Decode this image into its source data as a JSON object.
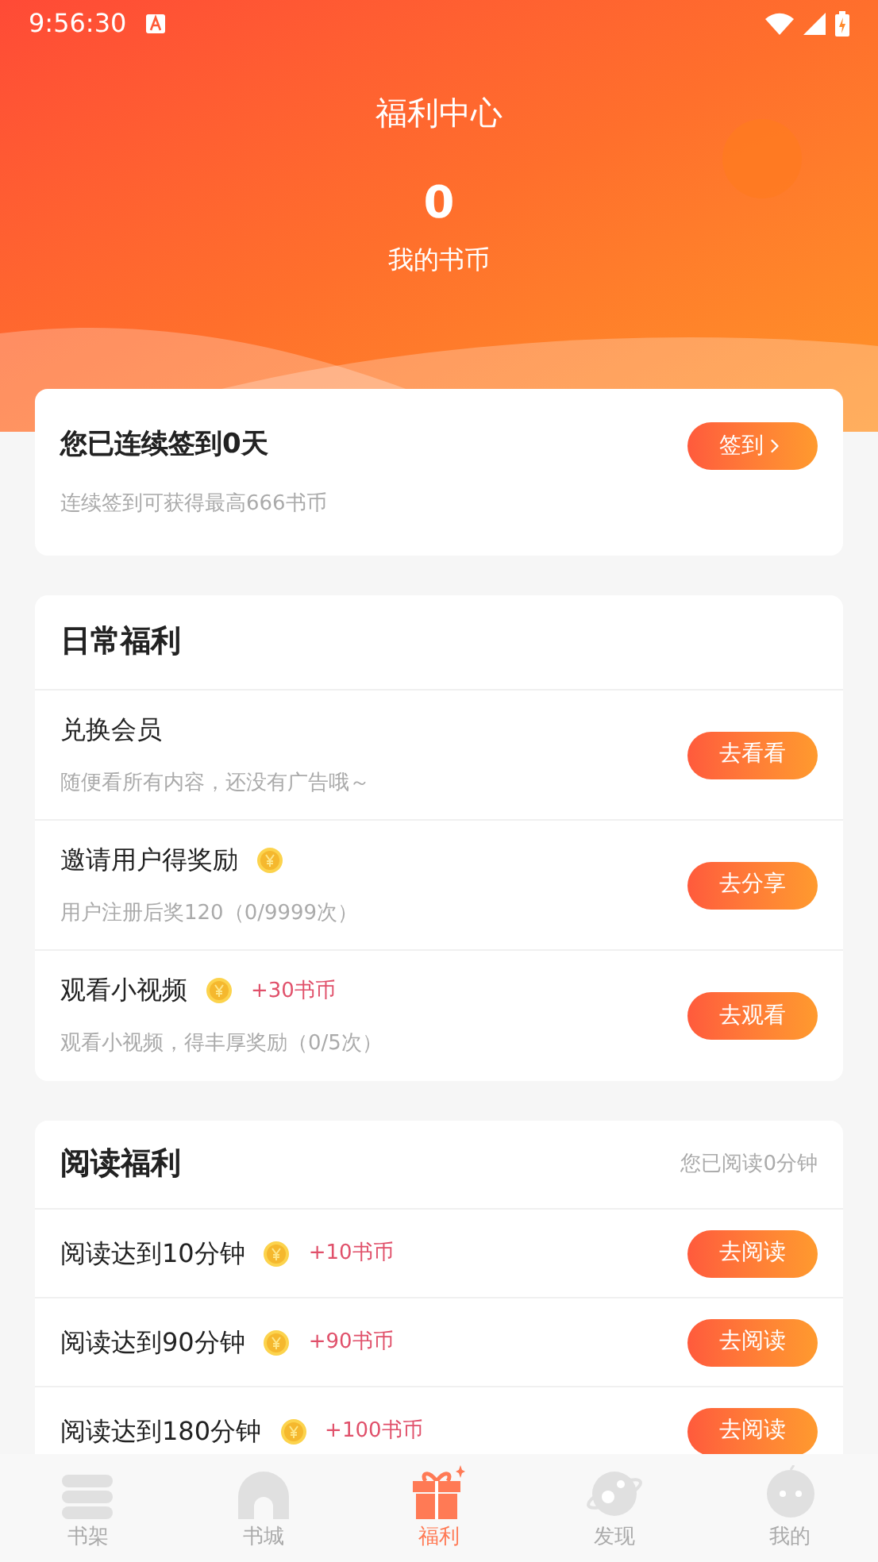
{
  "status_bar": {
    "time": "9:56:30"
  },
  "header": {
    "title": "福利中心",
    "coins": "0",
    "coins_label": "我的书币"
  },
  "checkin": {
    "text": "您已连续签到**0**天",
    "hint": "连续签到可获得最高666书币",
    "button": "签到"
  },
  "daily": {
    "title": "日常福利",
    "tasks": [
      {
        "title": "兑换会员",
        "coin_icon": false,
        "desc": "随便看所有内容，还没有广告哦～",
        "button": "去看看"
      },
      {
        "title": "邀请用户得奖励",
        "coin_icon": true,
        "desc": "用户注册后奖120（0/9999次）",
        "button": "去分享"
      },
      {
        "title": "观看小视频",
        "coin_icon": true,
        "reward": "+30书币",
        "desc": "观看小视频，得丰厚奖励（0/5次）",
        "button": "去观看"
      }
    ]
  },
  "reading": {
    "title": "阅读福利",
    "note": "您已阅读0分钟",
    "tasks": [
      {
        "title": "阅读达到10分钟",
        "reward": "+10书币",
        "button": "去阅读"
      },
      {
        "title": "阅读达到90分钟",
        "reward": "+90书币",
        "button": "去阅读"
      },
      {
        "title": "阅读达到180分钟",
        "reward": "+100书币",
        "button": "去阅读"
      }
    ]
  },
  "nav": [
    {
      "label": "书架",
      "kind": "shelf",
      "selected": false
    },
    {
      "label": "书城",
      "kind": "store",
      "selected": false
    },
    {
      "label": "福利",
      "kind": "gift",
      "selected": true
    },
    {
      "label": "发现",
      "kind": "planet",
      "selected": false
    },
    {
      "label": "我的",
      "kind": "face",
      "selected": false
    }
  ]
}
